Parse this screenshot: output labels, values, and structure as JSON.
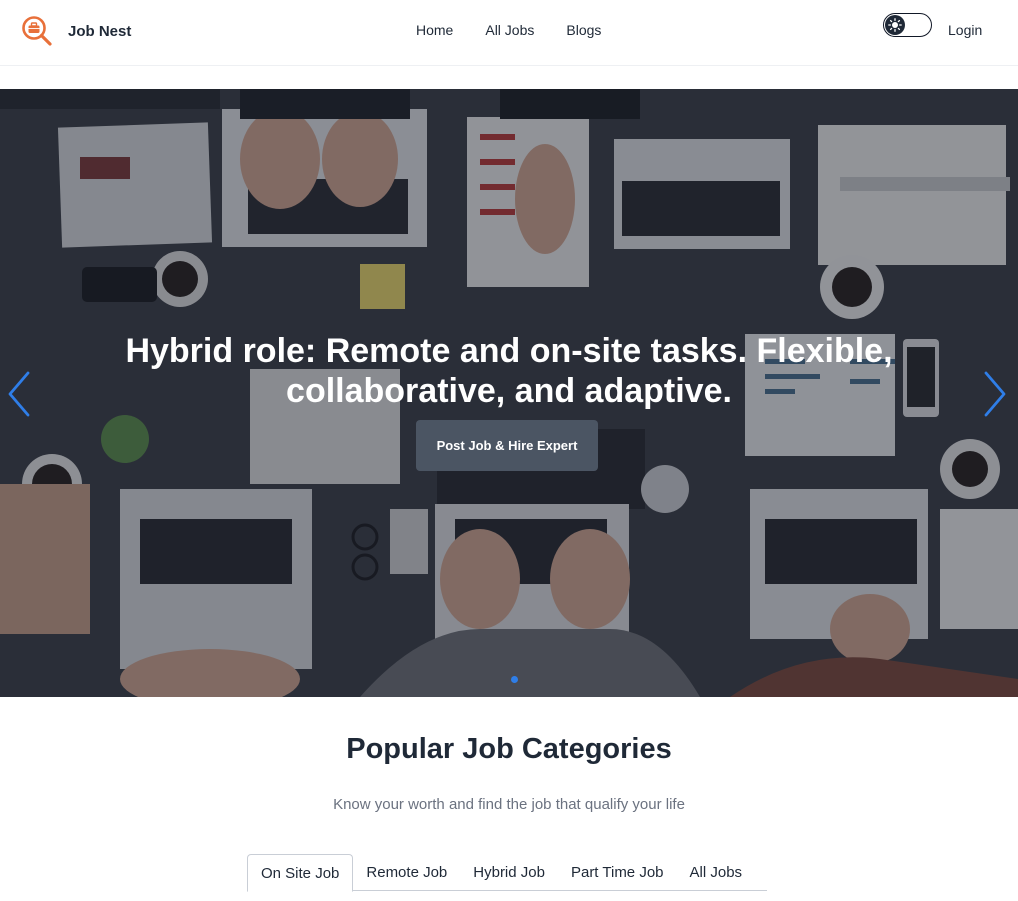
{
  "brand": {
    "name": "Job Nest",
    "icon": "briefcase-search-icon",
    "accent": "#e8703a"
  },
  "nav": {
    "links": [
      "Home",
      "All Jobs",
      "Blogs"
    ],
    "login": "Login",
    "theme_toggle_icon": "sun-icon"
  },
  "hero": {
    "title": "Hybrid role: Remote and on-site tasks. Flexible, collaborative, and adaptive.",
    "cta": "Post Job & Hire Expert",
    "prev_icon": "chevron-left-icon",
    "next_icon": "chevron-right-icon",
    "arrow_color": "#2f7ee8",
    "active_slide": 1
  },
  "categories": {
    "title": "Popular Job Categories",
    "subtitle": "Know your worth and find the job that qualify your life",
    "tabs": [
      "On Site Job",
      "Remote Job",
      "Hybrid Job",
      "Part Time Job",
      "All Jobs"
    ],
    "active_tab": "On Site Job"
  }
}
